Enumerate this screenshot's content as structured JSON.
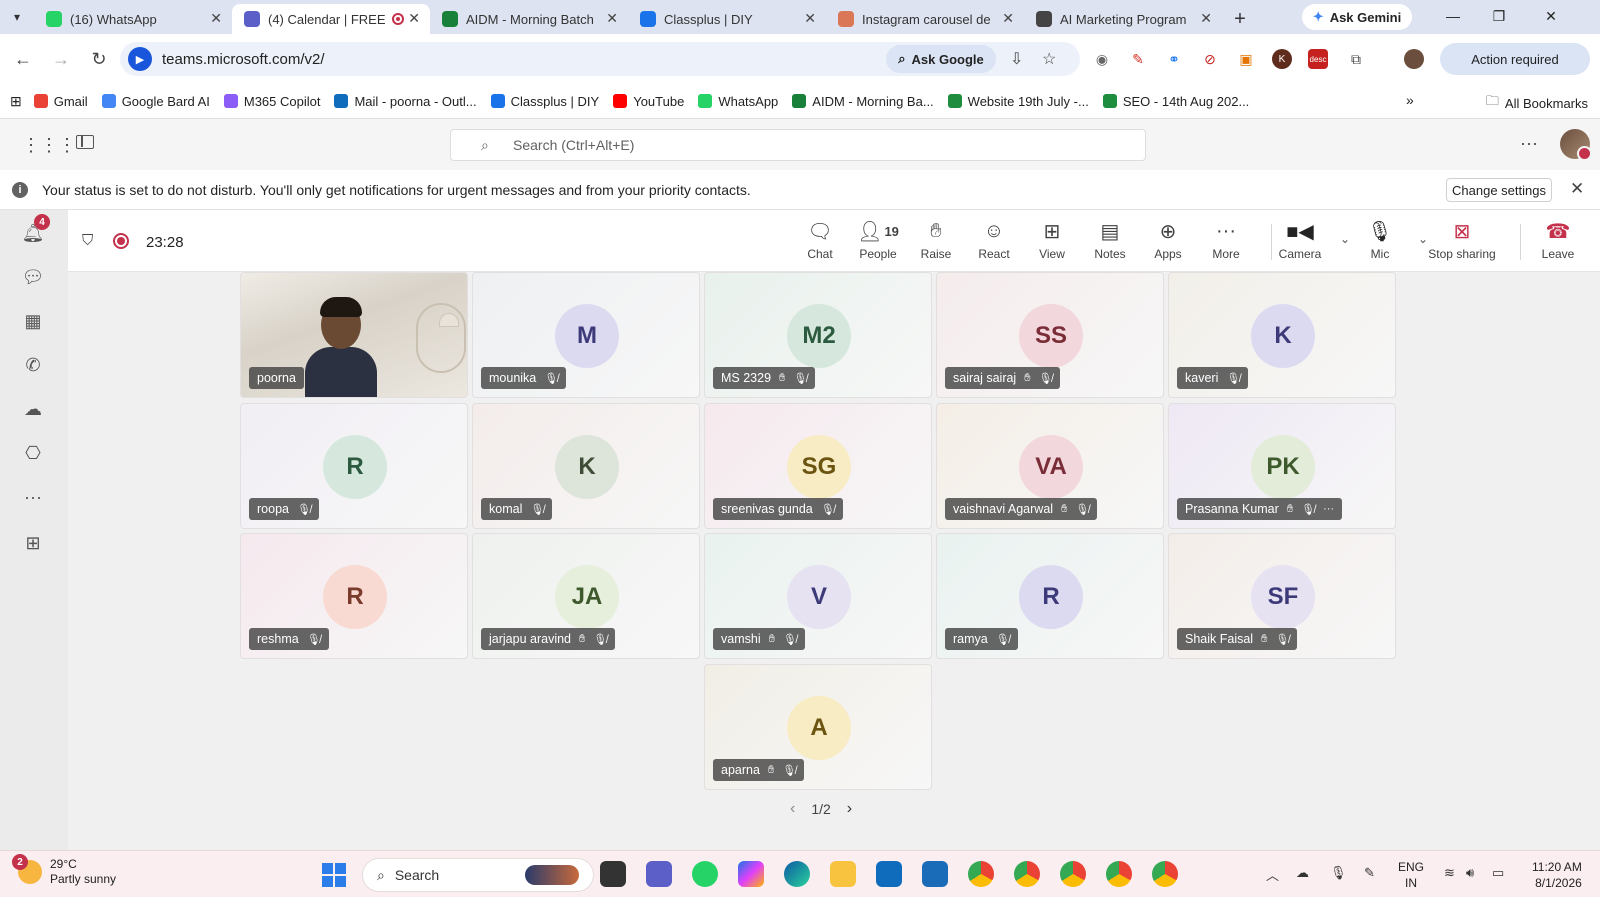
{
  "browser": {
    "tabs": [
      {
        "title": "(16) WhatsApp",
        "favicon_color": "#25d366",
        "favicon": "whatsapp-icon"
      },
      {
        "title": "(4) Calendar | FREE",
        "favicon_color": "#5b5fc7",
        "favicon": "teams-icon",
        "recording": true
      },
      {
        "title": "AIDM - Morning Batch",
        "favicon_color": "#188038",
        "favicon": "sheets-icon"
      },
      {
        "title": "Classplus | DIY",
        "favicon_color": "#1a73e8",
        "favicon": "classplus-icon"
      },
      {
        "title": "Instagram carousel de",
        "favicon_color": "#d97757",
        "favicon": "claude-icon"
      },
      {
        "title": "AI Marketing Program",
        "favicon_color": "#444444",
        "favicon": "openai-icon"
      }
    ],
    "gemini_label": "Ask Gemini",
    "url": "teams.microsoft.com/v2/",
    "ask_google_label": "Ask Google",
    "action_required_label": "Action required",
    "bookmarks": [
      {
        "label": "Gmail",
        "color": "#ea4335"
      },
      {
        "label": "Google Bard AI",
        "color": "#4285f4"
      },
      {
        "label": "M365 Copilot",
        "color": "#8b5cf6"
      },
      {
        "label": "Mail - poorna - Outl...",
        "color": "#0f6cbd"
      },
      {
        "label": "Classplus | DIY",
        "color": "#1a73e8"
      },
      {
        "label": "YouTube",
        "color": "#ff0000"
      },
      {
        "label": "WhatsApp",
        "color": "#25d366"
      },
      {
        "label": "AIDM - Morning Ba...",
        "color": "#188038"
      },
      {
        "label": "Website 19th July -...",
        "color": "#1e8e3e"
      },
      {
        "label": "SEO - 14th Aug 202...",
        "color": "#1e8e3e"
      }
    ],
    "all_bookmarks_label": "All Bookmarks"
  },
  "teams": {
    "search_placeholder": "Search (Ctrl+Alt+E)",
    "banner_text": "Your status is set to do not disturb. You'll only get notifications for urgent messages and from your priority contacts.",
    "change_settings_label": "Change settings",
    "activity_badge": "4"
  },
  "meeting": {
    "timer": "23:28",
    "controls": {
      "chat": "Chat",
      "people": "People",
      "people_count": "19",
      "raise": "Raise",
      "react": "React",
      "view": "View",
      "notes": "Notes",
      "apps": "Apps",
      "more": "More",
      "camera": "Camera",
      "mic": "Mic",
      "stop_sharing": "Stop sharing",
      "leave": "Leave"
    },
    "participants": [
      {
        "name": "poorna",
        "initials": "",
        "video": true
      },
      {
        "name": "mounika",
        "initials": "M",
        "avatar_bg": "#dcdaf0",
        "avatar_fg": "#3d3a7a",
        "tile_bg": "#eef0f2"
      },
      {
        "name": "MS 2329",
        "initials": "M2",
        "avatar_bg": "#d6e8de",
        "avatar_fg": "#2c5a3e",
        "tile_bg": "#e8f1ec",
        "hand": true
      },
      {
        "name": "sairaj sairaj",
        "initials": "SS",
        "avatar_bg": "#f2d8dc",
        "avatar_fg": "#7a2c37",
        "tile_bg": "#f5ecec",
        "hand": true
      },
      {
        "name": "kaveri",
        "initials": "K",
        "avatar_bg": "#dcdaf0",
        "avatar_fg": "#3d3a7a",
        "tile_bg": "#f2efe9"
      },
      {
        "name": "roopa",
        "initials": "R",
        "avatar_bg": "#d6e8de",
        "avatar_fg": "#2c5a3e",
        "tile_bg": "#f1eef4"
      },
      {
        "name": "komal",
        "initials": "K",
        "avatar_bg": "#dde4da",
        "avatar_fg": "#3e4e36",
        "tile_bg": "#f3ecea"
      },
      {
        "name": "sreenivas gunda",
        "initials": "SG",
        "avatar_bg": "#f8ecc4",
        "avatar_fg": "#6b5310",
        "tile_bg": "#f6e9ee"
      },
      {
        "name": "vaishnavi Agarwal",
        "initials": "VA",
        "avatar_bg": "#f2d8dc",
        "avatar_fg": "#7a2c37",
        "tile_bg": "#f4eee6",
        "hand": true
      },
      {
        "name": "Prasanna Kumar",
        "initials": "PK",
        "avatar_bg": "#e2ecd9",
        "avatar_fg": "#3e5a2c",
        "tile_bg": "#eee8f4",
        "hand": true,
        "more": true
      },
      {
        "name": "reshma",
        "initials": "R",
        "avatar_bg": "#f8dad2",
        "avatar_fg": "#7a3a2c",
        "tile_bg": "#f5e9ee"
      },
      {
        "name": "jarjapu aravind",
        "initials": "JA",
        "avatar_bg": "#e6eedc",
        "avatar_fg": "#3e5a2c",
        "tile_bg": "#eef1ee",
        "hand": true
      },
      {
        "name": "vamshi",
        "initials": "V",
        "avatar_bg": "#e6e2f2",
        "avatar_fg": "#3d3a7a",
        "tile_bg": "#e9f2ef",
        "hand": true
      },
      {
        "name": "ramya",
        "initials": "R",
        "avatar_bg": "#dcdaf0",
        "avatar_fg": "#3d3a7a",
        "tile_bg": "#e9f2f0"
      },
      {
        "name": "Shaik Faisal",
        "initials": "SF",
        "avatar_bg": "#e6e2f2",
        "avatar_fg": "#3d3a7a",
        "tile_bg": "#f3ede9",
        "hand": true
      },
      {
        "name": "aparna",
        "initials": "A",
        "avatar_bg": "#f8ecc4",
        "avatar_fg": "#6b5310",
        "tile_bg": "#f1eee6",
        "hand": true
      }
    ],
    "pager": "1/2"
  },
  "taskbar": {
    "weather_badge": "2",
    "temperature": "29°C",
    "condition": "Partly sunny",
    "search_label": "Search",
    "lang_line1": "ENG",
    "lang_line2": "IN",
    "time": "11:20 AM",
    "date": "8/1/2026"
  }
}
